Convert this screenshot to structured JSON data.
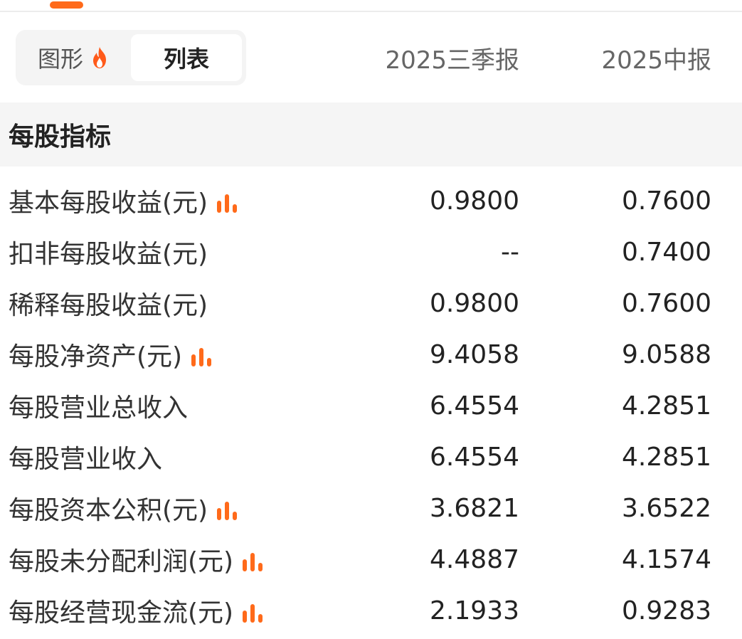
{
  "tabs": {
    "chart_label": "图形",
    "list_label": "列表"
  },
  "columns": [
    "2025三季报",
    "2025中报"
  ],
  "section": {
    "title": "每股指标"
  },
  "rows": [
    {
      "label": "基本每股收益(元)",
      "chart_icon": true,
      "q3": "0.9800",
      "h1": "0.7600"
    },
    {
      "label": "扣非每股收益(元)",
      "chart_icon": false,
      "q3": "--",
      "h1": "0.7400"
    },
    {
      "label": "稀释每股收益(元)",
      "chart_icon": false,
      "q3": "0.9800",
      "h1": "0.7600"
    },
    {
      "label": "每股净资产(元)",
      "chart_icon": true,
      "q3": "9.4058",
      "h1": "9.0588"
    },
    {
      "label": "每股营业总收入",
      "chart_icon": false,
      "q3": "6.4554",
      "h1": "4.2851"
    },
    {
      "label": "每股营业收入",
      "chart_icon": false,
      "q3": "6.4554",
      "h1": "4.2851"
    },
    {
      "label": "每股资本公积(元)",
      "chart_icon": true,
      "q3": "3.6821",
      "h1": "3.6522"
    },
    {
      "label": "每股未分配利润(元)",
      "chart_icon": true,
      "q3": "4.4887",
      "h1": "4.1574"
    },
    {
      "label": "每股经营现金流(元)",
      "chart_icon": true,
      "q3": "2.1933",
      "h1": "0.9283"
    }
  ],
  "colors": {
    "accent": "#ff6a1a",
    "section_bg": "#f5f5f5",
    "toggle_bg": "#f4f4f4"
  },
  "icons": {
    "hot": "fire-icon",
    "trend": "bar-chart-icon"
  }
}
